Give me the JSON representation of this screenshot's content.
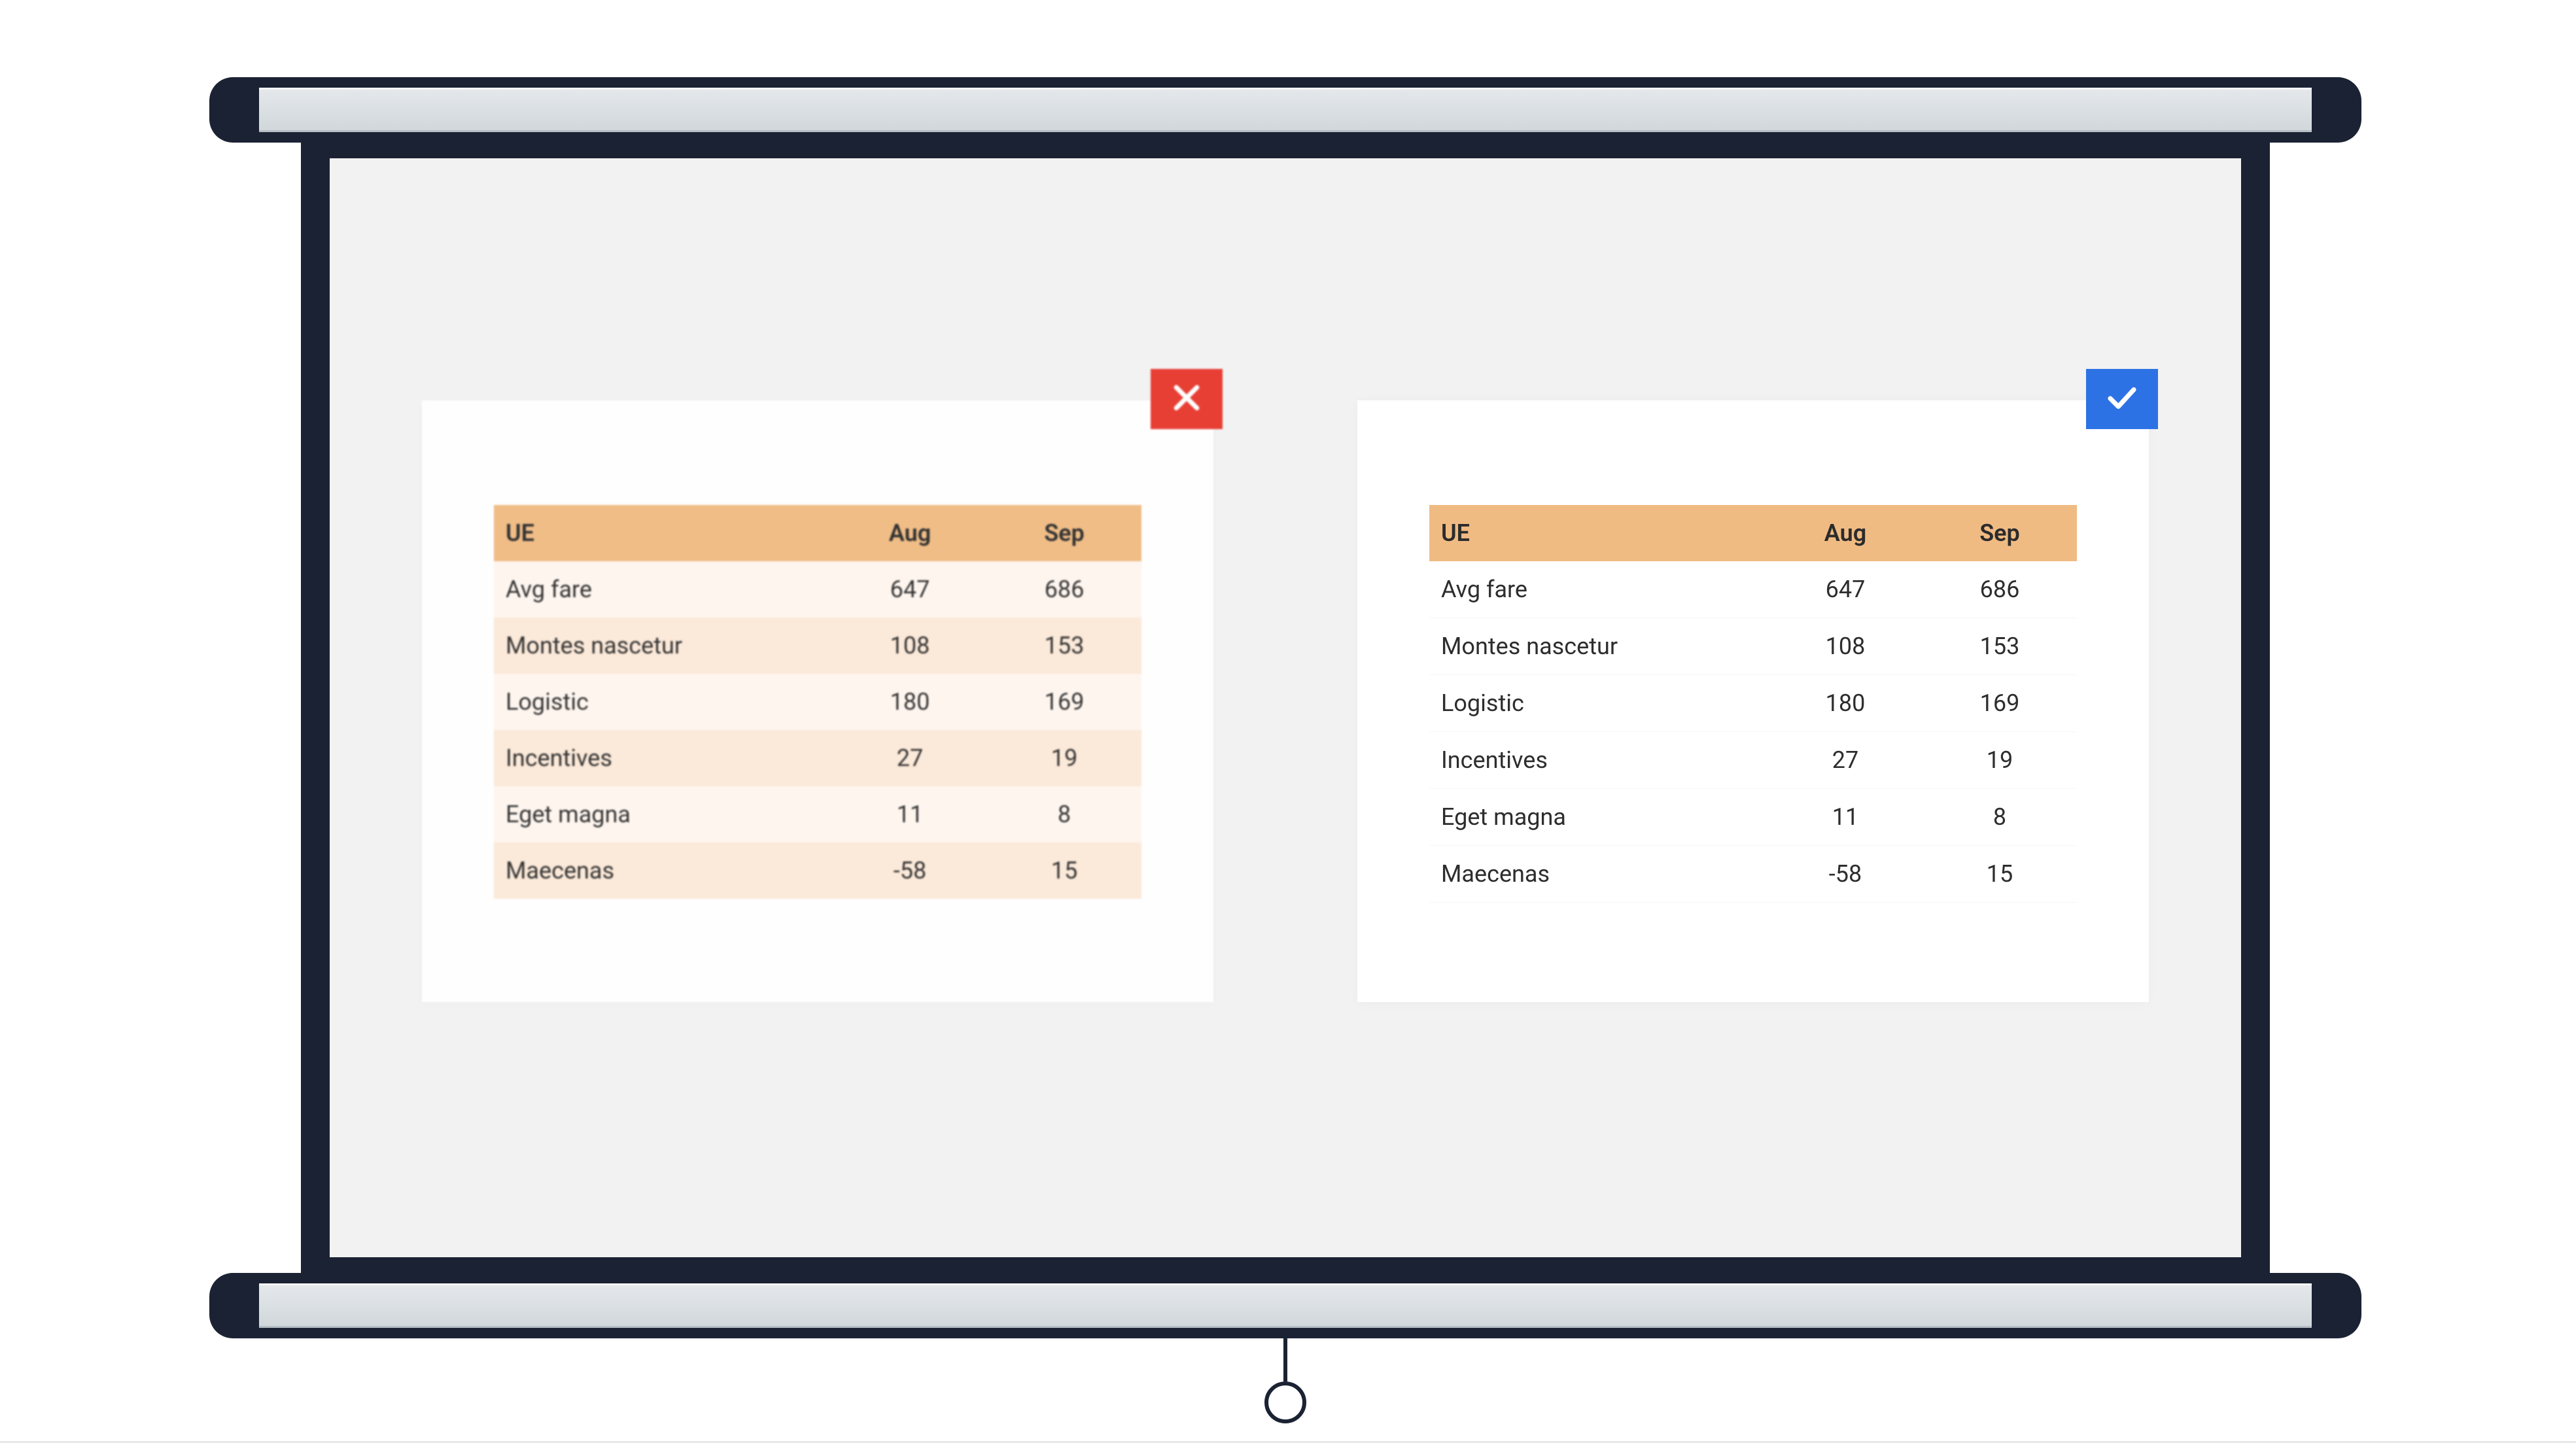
{
  "badges": {
    "bad_icon": "cross-icon",
    "good_icon": "check-icon",
    "bad_color": "#e8382e",
    "good_color": "#2d72e5"
  },
  "table": {
    "title": "UE",
    "columns": [
      "Aug",
      "Sep"
    ],
    "rows": [
      {
        "label": "Avg fare",
        "values": [
          "647",
          "686"
        ]
      },
      {
        "label": "Montes nascetur",
        "values": [
          "108",
          "153"
        ]
      },
      {
        "label": "Logistic",
        "values": [
          "180",
          "169"
        ]
      },
      {
        "label": "Incentives",
        "values": [
          "27",
          "19"
        ]
      },
      {
        "label": "Eget magna",
        "values": [
          "11",
          "8"
        ]
      },
      {
        "label": "Maecenas",
        "values": [
          "-58",
          "15"
        ]
      }
    ]
  }
}
